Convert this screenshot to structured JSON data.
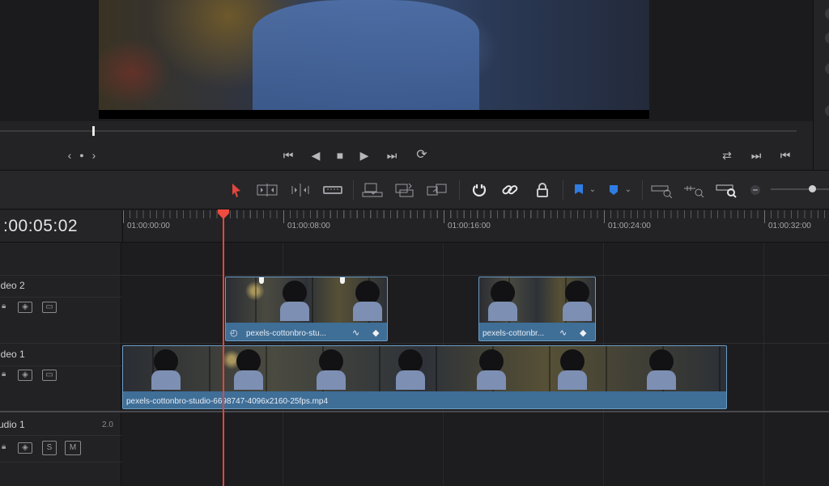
{
  "viewer": {
    "jog_labels": [
      "‹",
      "●",
      "›"
    ],
    "transport": {
      "rewind_start": "⏮",
      "play_reverse": "◀",
      "stop": "■",
      "play": "▶",
      "skip_end": "⏭",
      "loop": "⟳"
    },
    "right_controls": [
      "⇄",
      "⏭",
      "⏮"
    ]
  },
  "toolbar": {
    "icons": [
      "selection-arrow-icon",
      "trim-edit-icon",
      "dynamic-trim-icon",
      "blade-icon",
      "insert-clip-icon",
      "overwrite-clip-icon",
      "replace-clip-icon",
      "snapping-icon",
      "linked-selection-icon",
      "position-lock-icon",
      "flag-icon",
      "marker-icon",
      "full-extent-zoom-icon",
      "detail-zoom-icon",
      "custom-zoom-icon",
      "zoom-out-icon"
    ],
    "flag_color": "#2f7de3",
    "marker_color": "#2f7de3",
    "selection_color": "#e2463c"
  },
  "timeline": {
    "timecode": ":00:05:02",
    "ruler_labels": [
      "01:00:00:00",
      "01:00:08:00",
      "01:00:16:00",
      "01:00:24:00",
      "01:00:32:00"
    ],
    "playhead_color": "#e2463c"
  },
  "tracks": {
    "video2": {
      "name": "ideo 2"
    },
    "video1": {
      "name": "ideo 1"
    },
    "audio1": {
      "name": "udio 1",
      "channels": "2.0",
      "solo": "S",
      "mute": "M"
    }
  },
  "clips": {
    "v2_clip1": {
      "label": "pexels-cottonbro-stu..."
    },
    "v2_clip2": {
      "label": "pexels-cottonbr..."
    },
    "v1_clip": {
      "label": "pexels-cottonbro-studio-6698747-4096x2160-25fps.mp4"
    }
  }
}
